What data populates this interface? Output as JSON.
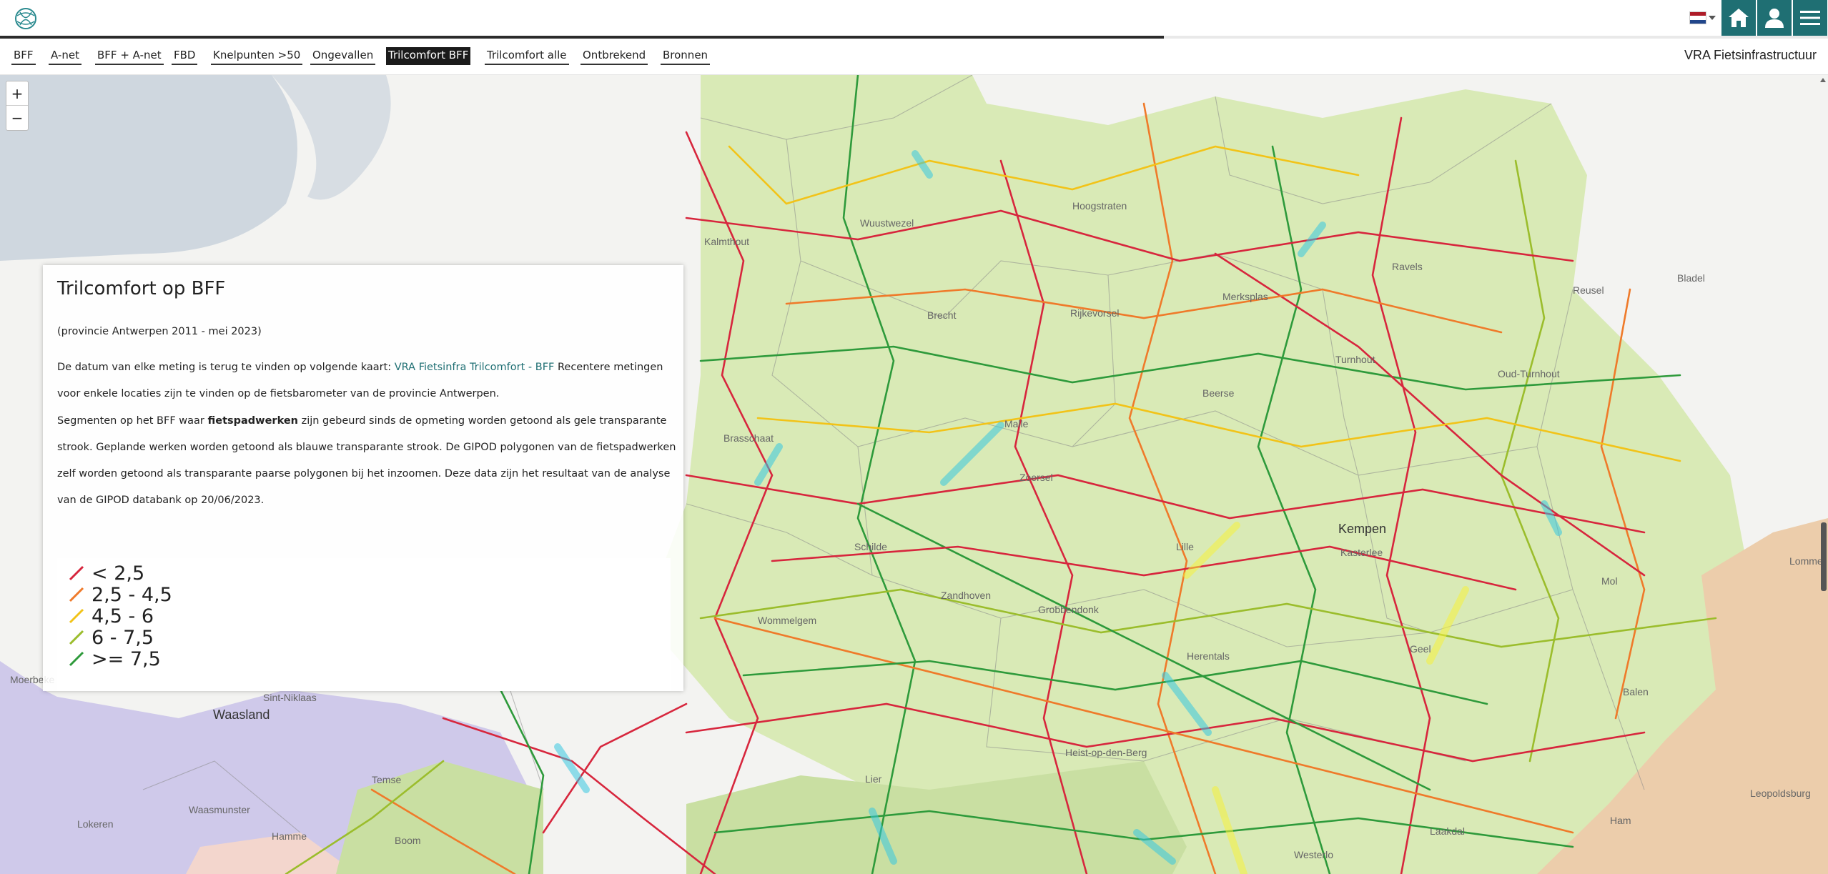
{
  "header": {
    "site_title": "VRA Fietsinfrastructuur",
    "language_flag": "netherlands-flag",
    "buttons": [
      "home-icon",
      "user-icon",
      "menu-icon"
    ],
    "accent_color": "#1f6f73"
  },
  "tabs": [
    {
      "label": "BFF"
    },
    {
      "label": "A-net"
    },
    {
      "label": "BFF + A-net"
    },
    {
      "label": "FBD"
    },
    {
      "label": "Knelpunten >50"
    },
    {
      "label": "Ongevallen"
    },
    {
      "label": "Trilcomfort BFF",
      "active": true
    },
    {
      "label": "Trilcomfort alle"
    },
    {
      "label": "Ontbrekend"
    },
    {
      "label": "Bronnen"
    }
  ],
  "map": {
    "zoom_in": "+",
    "zoom_out": "−",
    "places": [
      "Kalmthout",
      "Wuustwezel",
      "Hoogstraten",
      "Ravels",
      "Reusel",
      "Bladel",
      "Brecht",
      "Rijkevorsel",
      "Merksplas",
      "Turnhout",
      "Oud-Turnhout",
      "Brasschaat",
      "Malle",
      "Beerse",
      "Zoersel",
      "Schilde",
      "Lille",
      "Kasterlee",
      "Mol",
      "Kempen",
      "Wommelgem",
      "Zandhoven",
      "Grobbendonk",
      "Herentals",
      "Geel",
      "Balen",
      "Lommel",
      "Waasland",
      "Sint-Niklaas",
      "Temse",
      "Moerbeke",
      "Lokeren",
      "Hamme",
      "Waasmunster",
      "Boom",
      "Lier",
      "Heist-op-den-Berg",
      "Westerlo",
      "Laakdal",
      "Ham",
      "Leopoldsburg"
    ]
  },
  "info_panel": {
    "title": "Trilcomfort op BFF",
    "subtitle": "(provincie Antwerpen 2011 - mei 2023)",
    "p1_before": "De datum van elke meting is terug te vinden op volgende kaart: ",
    "p1_link": "VRA Fietsinfra Trilcomfort - BFF",
    "p1_after": " Recentere metingen voor enkele locaties zijn te vinden op de fietsbarometer van de provincie Antwerpen.",
    "p2_before": "Segmenten op het BFF waar ",
    "p2_bold": "fietspadwerken",
    "p2_after": " zijn gebeurd sinds de opmeting worden getoond als gele transparante strook. Geplande werken worden getoond als blauwe transparante strook. De GIPOD polygonen van de fietspadwerken zelf worden getoond als transparante paarse polygonen bij het inzoomen. Deze data zijn het resultaat van de analyse van de GIPOD databank op 20/06/2023.",
    "legend": [
      {
        "label": "< 2,5",
        "color": "#d7263d"
      },
      {
        "label": "2,5 - 4,5",
        "color": "#ef7a2a"
      },
      {
        "label": "4,5 - 6",
        "color": "#f2c318"
      },
      {
        "label": "6 - 7,5",
        "color": "#9bbd2c"
      },
      {
        "label": ">= 7,5",
        "color": "#2e9a3b"
      }
    ]
  }
}
